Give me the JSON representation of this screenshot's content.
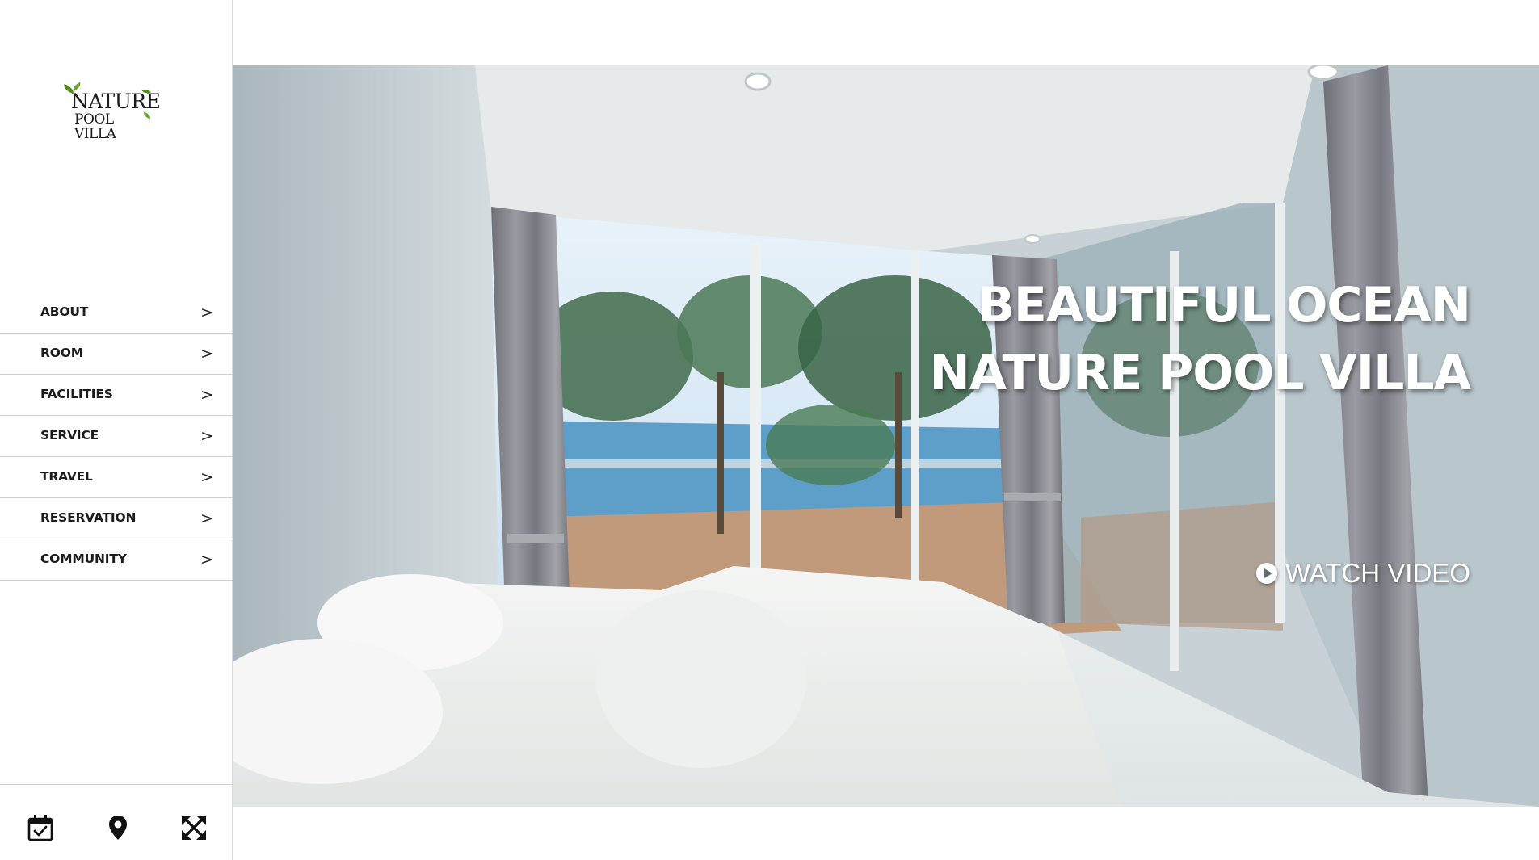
{
  "brand": {
    "logo_line1": "NATURE",
    "logo_line2": "POOL VILLA",
    "leaf_color": "#4e8a1c"
  },
  "sidebar": {
    "items": [
      {
        "label": "ABOUT",
        "chevron": ">"
      },
      {
        "label": "ROOM",
        "chevron": ">"
      },
      {
        "label": "FACILITIES",
        "chevron": ">"
      },
      {
        "label": "SERVICE",
        "chevron": ">"
      },
      {
        "label": "TRAVEL",
        "chevron": ">"
      },
      {
        "label": "RESERVATION",
        "chevron": ">"
      },
      {
        "label": "COMMUNITY",
        "chevron": ">"
      }
    ],
    "footer_icons": [
      "calendar-check-icon",
      "location-pin-icon",
      "expand-arrows-icon"
    ]
  },
  "hero": {
    "headline_line1": "BEAUTIFUL OCEAN",
    "headline_line2": "NATURE POOL VILLA",
    "watch_label": "WATCH VIDEO",
    "watch_icon": "play-circle-icon",
    "image_description_icon": "hero-photo"
  },
  "colors": {
    "text": "#1c1c1c",
    "headline": "#ffffff",
    "divider": "#cfcfcf"
  }
}
